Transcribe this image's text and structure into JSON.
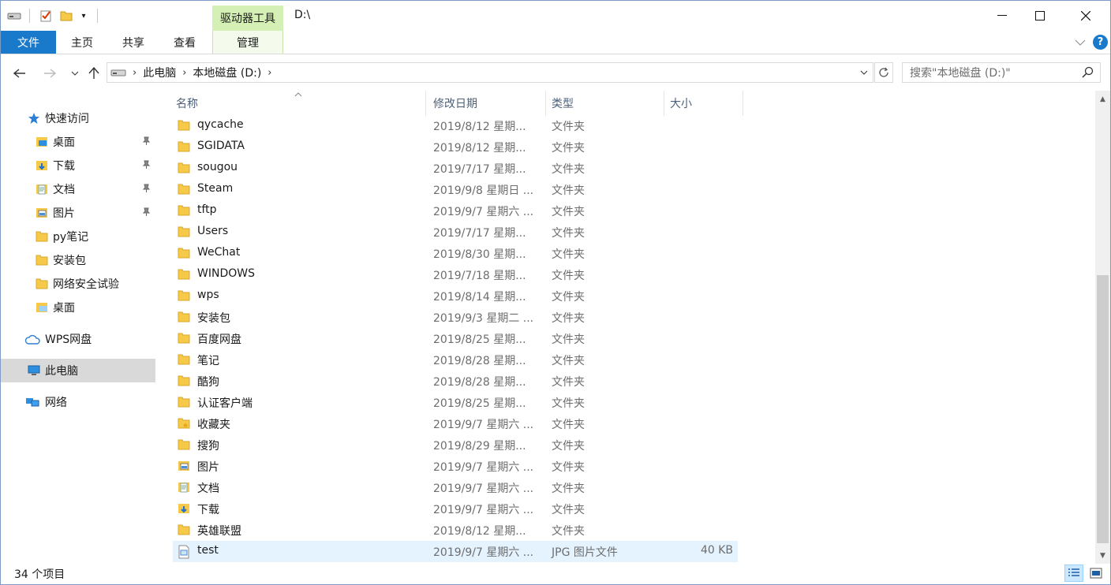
{
  "window": {
    "title": "D:\\",
    "context_group": "驱动器工具"
  },
  "ribbon": {
    "tabs": [
      {
        "label": "文件"
      },
      {
        "label": "主页"
      },
      {
        "label": "共享"
      },
      {
        "label": "查看"
      },
      {
        "label": "管理"
      }
    ]
  },
  "address": {
    "crumbs": [
      "此电脑",
      "本地磁盘 (D:)"
    ],
    "search_placeholder": "搜索\"本地磁盘 (D:)\""
  },
  "nav": {
    "items": [
      {
        "label": "快速访问",
        "icon": "star-icon"
      },
      {
        "label": "桌面",
        "icon": "desktop-folder-icon",
        "pinned": true
      },
      {
        "label": "下载",
        "icon": "download-folder-icon",
        "pinned": true
      },
      {
        "label": "文档",
        "icon": "documents-folder-icon",
        "pinned": true
      },
      {
        "label": "图片",
        "icon": "pictures-folder-icon",
        "pinned": true
      },
      {
        "label": "py笔记",
        "icon": "folder-icon"
      },
      {
        "label": "安装包",
        "icon": "folder-icon"
      },
      {
        "label": "网络安全试验",
        "icon": "folder-icon"
      },
      {
        "label": "桌面",
        "icon": "desktop-folder-icon"
      },
      {
        "label": "WPS网盘",
        "icon": "cloud-icon"
      },
      {
        "label": "此电脑",
        "icon": "computer-icon",
        "selected": true
      },
      {
        "label": "网络",
        "icon": "network-icon"
      }
    ]
  },
  "columns": {
    "name": "名称",
    "date": "修改日期",
    "type": "类型",
    "size": "大小"
  },
  "files": [
    {
      "name": "qycache",
      "date": "2019/8/12 星期...",
      "type": "文件夹",
      "size": "",
      "icon": "folder-icon"
    },
    {
      "name": "SGIDATA",
      "date": "2019/8/12 星期...",
      "type": "文件夹",
      "size": "",
      "icon": "folder-icon"
    },
    {
      "name": "sougou",
      "date": "2019/7/17 星期...",
      "type": "文件夹",
      "size": "",
      "icon": "folder-icon"
    },
    {
      "name": "Steam",
      "date": "2019/9/8 星期日 ...",
      "type": "文件夹",
      "size": "",
      "icon": "folder-icon"
    },
    {
      "name": "tftp",
      "date": "2019/9/7 星期六 ...",
      "type": "文件夹",
      "size": "",
      "icon": "folder-icon"
    },
    {
      "name": "Users",
      "date": "2019/7/17 星期...",
      "type": "文件夹",
      "size": "",
      "icon": "folder-icon"
    },
    {
      "name": "WeChat",
      "date": "2019/8/30 星期...",
      "type": "文件夹",
      "size": "",
      "icon": "folder-icon"
    },
    {
      "name": "WINDOWS",
      "date": "2019/7/18 星期...",
      "type": "文件夹",
      "size": "",
      "icon": "folder-icon"
    },
    {
      "name": "wps",
      "date": "2019/8/14 星期...",
      "type": "文件夹",
      "size": "",
      "icon": "folder-icon"
    },
    {
      "name": "安装包",
      "date": "2019/9/3 星期二 ...",
      "type": "文件夹",
      "size": "",
      "icon": "folder-icon"
    },
    {
      "name": "百度网盘",
      "date": "2019/8/25 星期...",
      "type": "文件夹",
      "size": "",
      "icon": "folder-icon"
    },
    {
      "name": "笔记",
      "date": "2019/8/28 星期...",
      "type": "文件夹",
      "size": "",
      "icon": "folder-icon"
    },
    {
      "name": "酷狗",
      "date": "2019/8/28 星期...",
      "type": "文件夹",
      "size": "",
      "icon": "folder-icon"
    },
    {
      "name": "认证客户端",
      "date": "2019/8/25 星期...",
      "type": "文件夹",
      "size": "",
      "icon": "folder-icon"
    },
    {
      "name": "收藏夹",
      "date": "2019/9/7 星期六 ...",
      "type": "文件夹",
      "size": "",
      "icon": "favorites-folder-icon"
    },
    {
      "name": "搜狗",
      "date": "2019/8/29 星期...",
      "type": "文件夹",
      "size": "",
      "icon": "folder-icon"
    },
    {
      "name": "图片",
      "date": "2019/9/7 星期六 ...",
      "type": "文件夹",
      "size": "",
      "icon": "pictures-folder-icon"
    },
    {
      "name": "文档",
      "date": "2019/9/7 星期六 ...",
      "type": "文件夹",
      "size": "",
      "icon": "documents-folder-icon"
    },
    {
      "name": "下载",
      "date": "2019/9/7 星期六 ...",
      "type": "文件夹",
      "size": "",
      "icon": "download-folder-icon"
    },
    {
      "name": "英雄联盟",
      "date": "2019/8/12 星期...",
      "type": "文件夹",
      "size": "",
      "icon": "folder-icon"
    },
    {
      "name": "test",
      "date": "2019/9/7 星期六 ...",
      "type": "JPG 图片文件",
      "size": "40 KB",
      "icon": "image-file-icon",
      "selected": true
    }
  ],
  "status": {
    "count": "34 个项目"
  },
  "colors": {
    "accent": "#1979ca",
    "context_green": "#d4f0b4",
    "selected_row": "#e5f3ff",
    "folder": "#f7c948"
  }
}
